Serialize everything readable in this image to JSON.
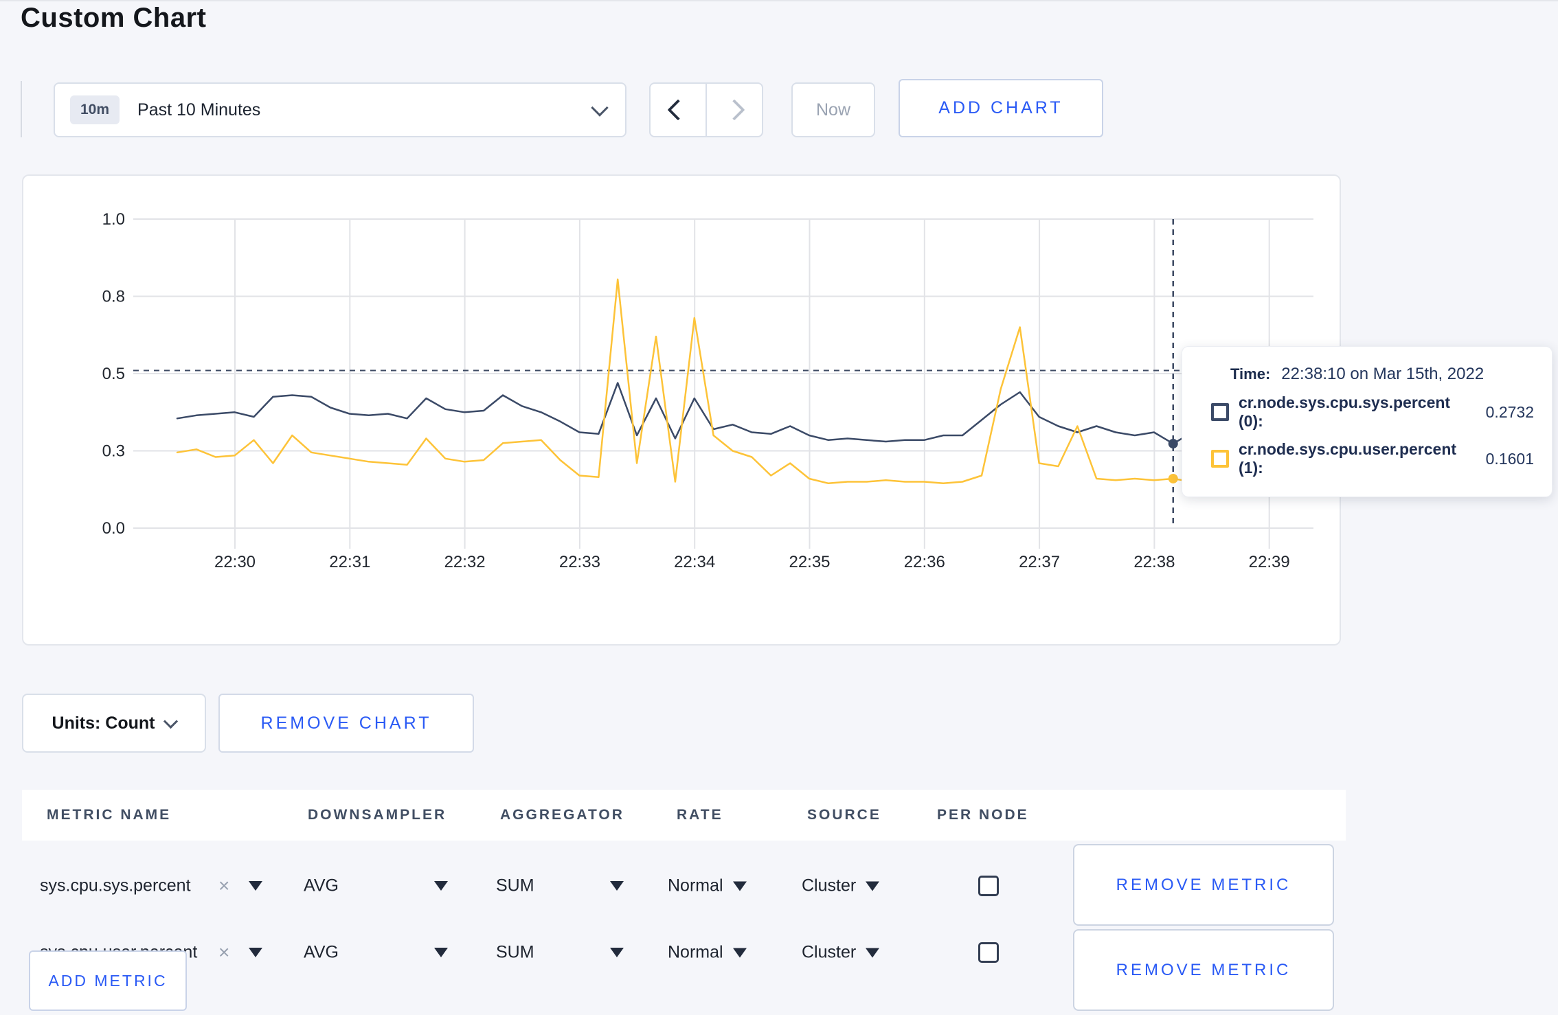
{
  "page": {
    "title": "Custom Chart"
  },
  "toolbar": {
    "time_range_badge": "10m",
    "time_range_label": "Past 10 Minutes",
    "now_label": "Now",
    "add_chart_label": "ADD CHART"
  },
  "chart_controls": {
    "units_label": "Units: Count",
    "remove_chart_label": "REMOVE CHART"
  },
  "metrics_table": {
    "headers": {
      "metric_name": "METRIC NAME",
      "downsampler": "DOWNSAMPLER",
      "aggregator": "AGGREGATOR",
      "rate": "RATE",
      "source": "SOURCE",
      "per_node": "PER NODE"
    },
    "rows": [
      {
        "metric_name": "sys.cpu.sys.percent",
        "downsampler": "AVG",
        "aggregator": "SUM",
        "rate": "Normal",
        "source": "Cluster",
        "per_node_checked": false,
        "remove_label": "REMOVE METRIC"
      },
      {
        "metric_name": "sys.cpu.user.percent",
        "downsampler": "AVG",
        "aggregator": "SUM",
        "rate": "Normal",
        "source": "Cluster",
        "per_node_checked": false,
        "remove_label": "REMOVE METRIC"
      }
    ],
    "add_metric_label": "ADD METRIC"
  },
  "icons": {
    "clear_x": "×"
  },
  "colors": {
    "accent_blue": "#2a5af5",
    "page_bg": "#f5f6fa",
    "card_border": "#e3e6ec"
  },
  "chart_data": {
    "type": "line",
    "title": "",
    "xlabel": "",
    "ylabel": "",
    "grid": true,
    "legend_position": "tooltip-only",
    "x_axis": {
      "start_time": "22:29:30",
      "step_seconds": 10,
      "labels": [
        "22:30",
        "22:31",
        "22:32",
        "22:33",
        "22:34",
        "22:35",
        "22:36",
        "22:37",
        "22:38",
        "22:39"
      ]
    },
    "y_axis": {
      "min": 0,
      "max": 1.0,
      "ticks": [
        {
          "value": 0,
          "label": "0.0"
        },
        {
          "value": 0.25,
          "label": "0.3"
        },
        {
          "value": 0.5,
          "label": "0.5"
        },
        {
          "value": 0.75,
          "label": "0.8"
        },
        {
          "value": 1.0,
          "label": "1.0"
        }
      ]
    },
    "colors": {
      "grid": "#e2e3e7",
      "axis_text": "#22272f",
      "crosshair": "#3d4a63"
    },
    "series": [
      {
        "name": "cr.node.sys.cpu.sys.percent",
        "color": "#3b4a67",
        "values": [
          0.355,
          0.365,
          0.37,
          0.375,
          0.36,
          0.425,
          0.43,
          0.425,
          0.39,
          0.37,
          0.365,
          0.37,
          0.355,
          0.42,
          0.385,
          0.375,
          0.38,
          0.43,
          0.395,
          0.375,
          0.345,
          0.31,
          0.305,
          0.47,
          0.3,
          0.42,
          0.29,
          0.42,
          0.32,
          0.335,
          0.31,
          0.305,
          0.33,
          0.3,
          0.285,
          0.29,
          0.285,
          0.28,
          0.285,
          0.285,
          0.3,
          0.3,
          0.35,
          0.4,
          0.44,
          0.36,
          0.33,
          0.31,
          0.33,
          0.31,
          0.3,
          0.31,
          0.2732,
          0.31,
          0.33,
          0.3,
          0.315,
          0.3,
          0.305,
          0.315
        ]
      },
      {
        "name": "cr.node.sys.cpu.user.percent",
        "color": "#fdc338",
        "values": [
          0.245,
          0.255,
          0.23,
          0.235,
          0.285,
          0.21,
          0.3,
          0.245,
          0.235,
          0.225,
          0.215,
          0.21,
          0.205,
          0.29,
          0.225,
          0.215,
          0.22,
          0.275,
          0.28,
          0.285,
          0.22,
          0.17,
          0.165,
          0.805,
          0.21,
          0.62,
          0.15,
          0.68,
          0.3,
          0.25,
          0.23,
          0.17,
          0.21,
          0.16,
          0.145,
          0.15,
          0.15,
          0.155,
          0.15,
          0.15,
          0.145,
          0.15,
          0.17,
          0.45,
          0.65,
          0.21,
          0.2,
          0.33,
          0.16,
          0.155,
          0.16,
          0.155,
          0.1601,
          0.15,
          0.15,
          0.28,
          0.26,
          0.27,
          0.17,
          0.28
        ]
      }
    ],
    "hover": {
      "index": 52,
      "crosshair_y_value": 0.51,
      "time_prefix": "Time:",
      "time_label": "22:38:10 on Mar 15th, 2022",
      "rows": [
        {
          "label": "cr.node.sys.cpu.sys.percent (0):",
          "value": "0.2732"
        },
        {
          "label": "cr.node.sys.cpu.user.percent (1):",
          "value": "0.1601"
        }
      ],
      "values": [
        0.2732,
        0.1601
      ]
    }
  }
}
